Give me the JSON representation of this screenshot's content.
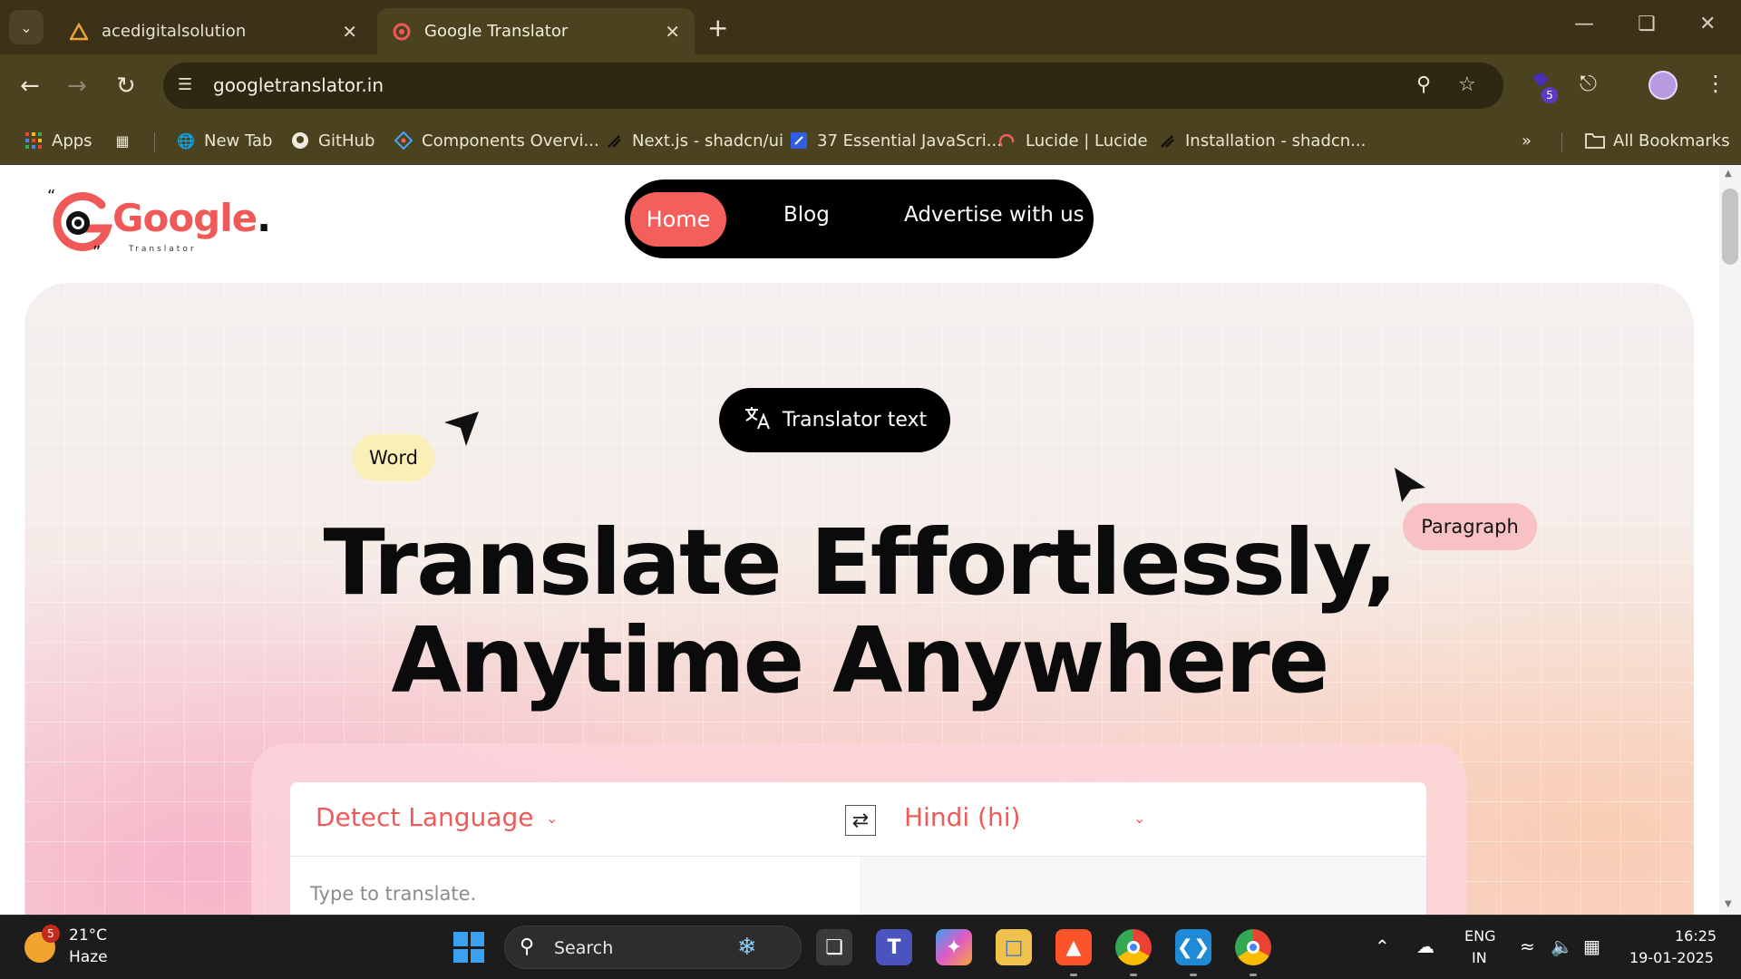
{
  "browser": {
    "tabs": [
      {
        "title": "acedigitalsolution",
        "active": false,
        "favicon": "warning-triangle-logo"
      },
      {
        "title": "Google Translator",
        "active": true,
        "favicon": "google-translator-logo"
      }
    ],
    "url": "googletranslator.in",
    "extension_badge": "5",
    "bookmarks": [
      {
        "label": "Apps",
        "icon": "apps-grid-icon"
      },
      {
        "label": "",
        "icon": "tab-grid-icon"
      },
      {
        "label": "New Tab",
        "icon": "globe-icon"
      },
      {
        "label": "GitHub",
        "icon": "github-icon"
      },
      {
        "label": "Components Overvi...",
        "icon": "component-icon"
      },
      {
        "label": "Next.js - shadcn/ui",
        "icon": "slash-icon"
      },
      {
        "label": "37 Essential JavaScri...",
        "icon": "bookmark-blue-icon"
      },
      {
        "label": "Lucide | Lucide",
        "icon": "lucide-icon"
      },
      {
        "label": "Installation - shadcn...",
        "icon": "slash-icon"
      }
    ],
    "all_bookmarks": "All Bookmarks"
  },
  "site": {
    "logo_text": "Google",
    "logo_sub": "Translator",
    "nav": {
      "home": "Home",
      "blog": "Blog",
      "advertise": "Advertise with us"
    },
    "chip_label": "Translator text",
    "float_word": "Word",
    "float_paragraph": "Paragraph",
    "headline_line1": "Translate Effortlessly,",
    "headline_line2": "Anytime Anywhere",
    "translator": {
      "source_language": "Detect Language",
      "target_language": "Hindi (hi)",
      "input_placeholder": "Type to translate.",
      "input_value": ""
    },
    "colors": {
      "accent": "#f35f5b",
      "nav_bg": "#000000",
      "word_chip": "#fbefb8",
      "paragraph_chip": "#f8c2c4"
    }
  },
  "taskbar": {
    "weather_temp": "21°C",
    "weather_desc": "Haze",
    "weather_badge": "5",
    "search_label": "Search",
    "lang_top": "ENG",
    "lang_bottom": "IN",
    "time": "16:25",
    "date": "19-01-2025"
  }
}
